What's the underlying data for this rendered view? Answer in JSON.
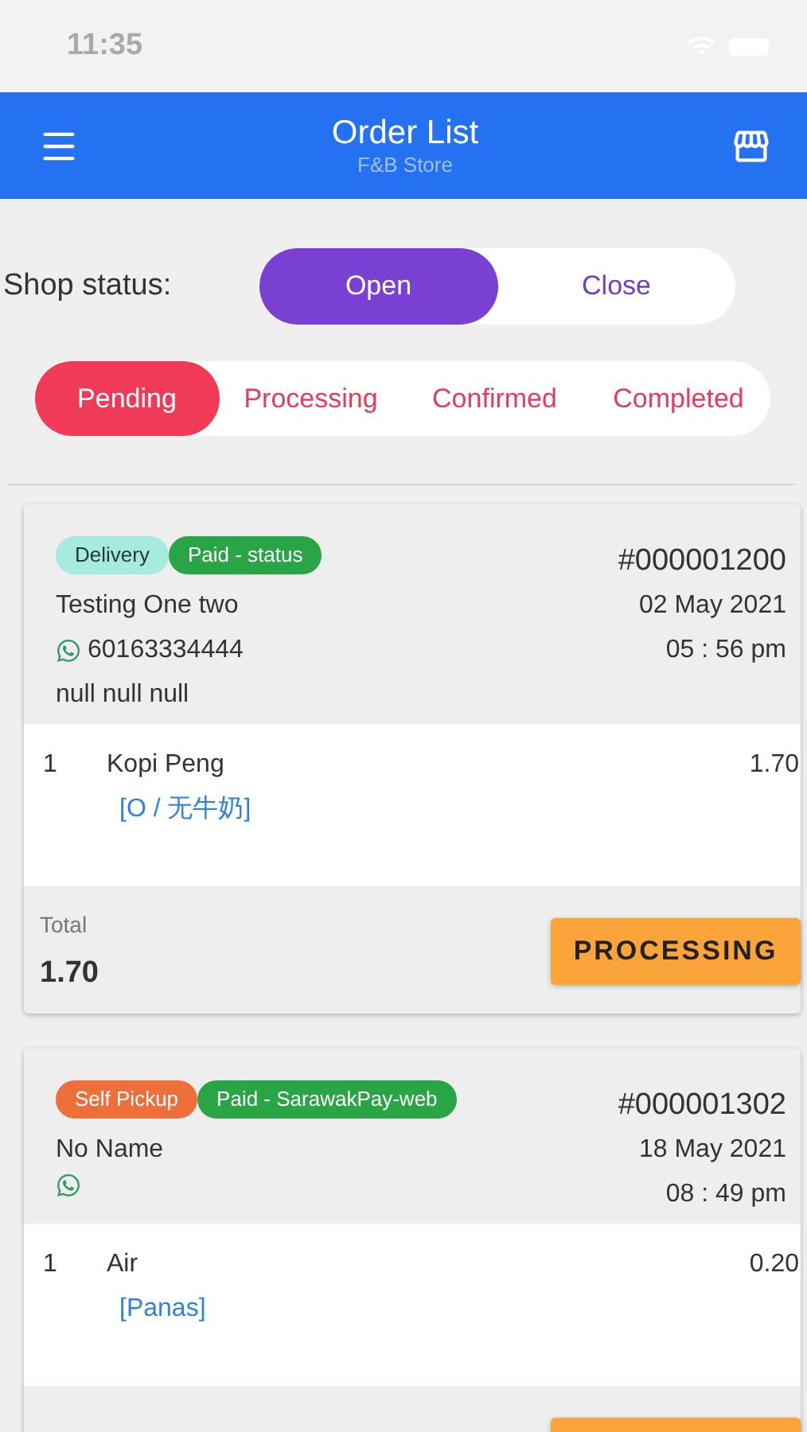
{
  "status_bar": {
    "time": "11:35"
  },
  "header": {
    "title": "Order List",
    "subtitle": "F&B Store"
  },
  "shop_status": {
    "label": "Shop status:",
    "options": [
      {
        "label": "Open",
        "selected": true
      },
      {
        "label": "Close",
        "selected": false
      }
    ]
  },
  "tabs": [
    {
      "label": "Pending",
      "selected": true
    },
    {
      "label": "Processing",
      "selected": false
    },
    {
      "label": "Confirmed",
      "selected": false
    },
    {
      "label": "Completed",
      "selected": false
    }
  ],
  "orders": [
    {
      "tags": [
        {
          "label": "Delivery",
          "color": "#a6ebdd"
        },
        {
          "label": "Paid - status",
          "color": "#2aa546"
        }
      ],
      "order_no": "#000001200",
      "customer": "Testing One two",
      "phone": "60163334444",
      "address": "null null null",
      "date": "02 May 2021",
      "time": "05 : 56 pm",
      "items": [
        {
          "qty": "1",
          "name": "Kopi Peng",
          "price": "1.70",
          "options": "[O / 无牛奶]"
        }
      ],
      "total_label": "Total",
      "total": "1.70",
      "action": "PROCESSING"
    },
    {
      "tags": [
        {
          "label": "Self Pickup",
          "color": "#ee6f3c"
        },
        {
          "label": "Paid - SarawakPay-web",
          "color": "#2aa546"
        }
      ],
      "order_no": "#000001302",
      "customer": "No Name",
      "date": "18 May 2021",
      "time": "08 : 49 pm",
      "items": [
        {
          "qty": "1",
          "name": "Air",
          "price": "0.20",
          "options": "[Panas]"
        }
      ]
    }
  ]
}
